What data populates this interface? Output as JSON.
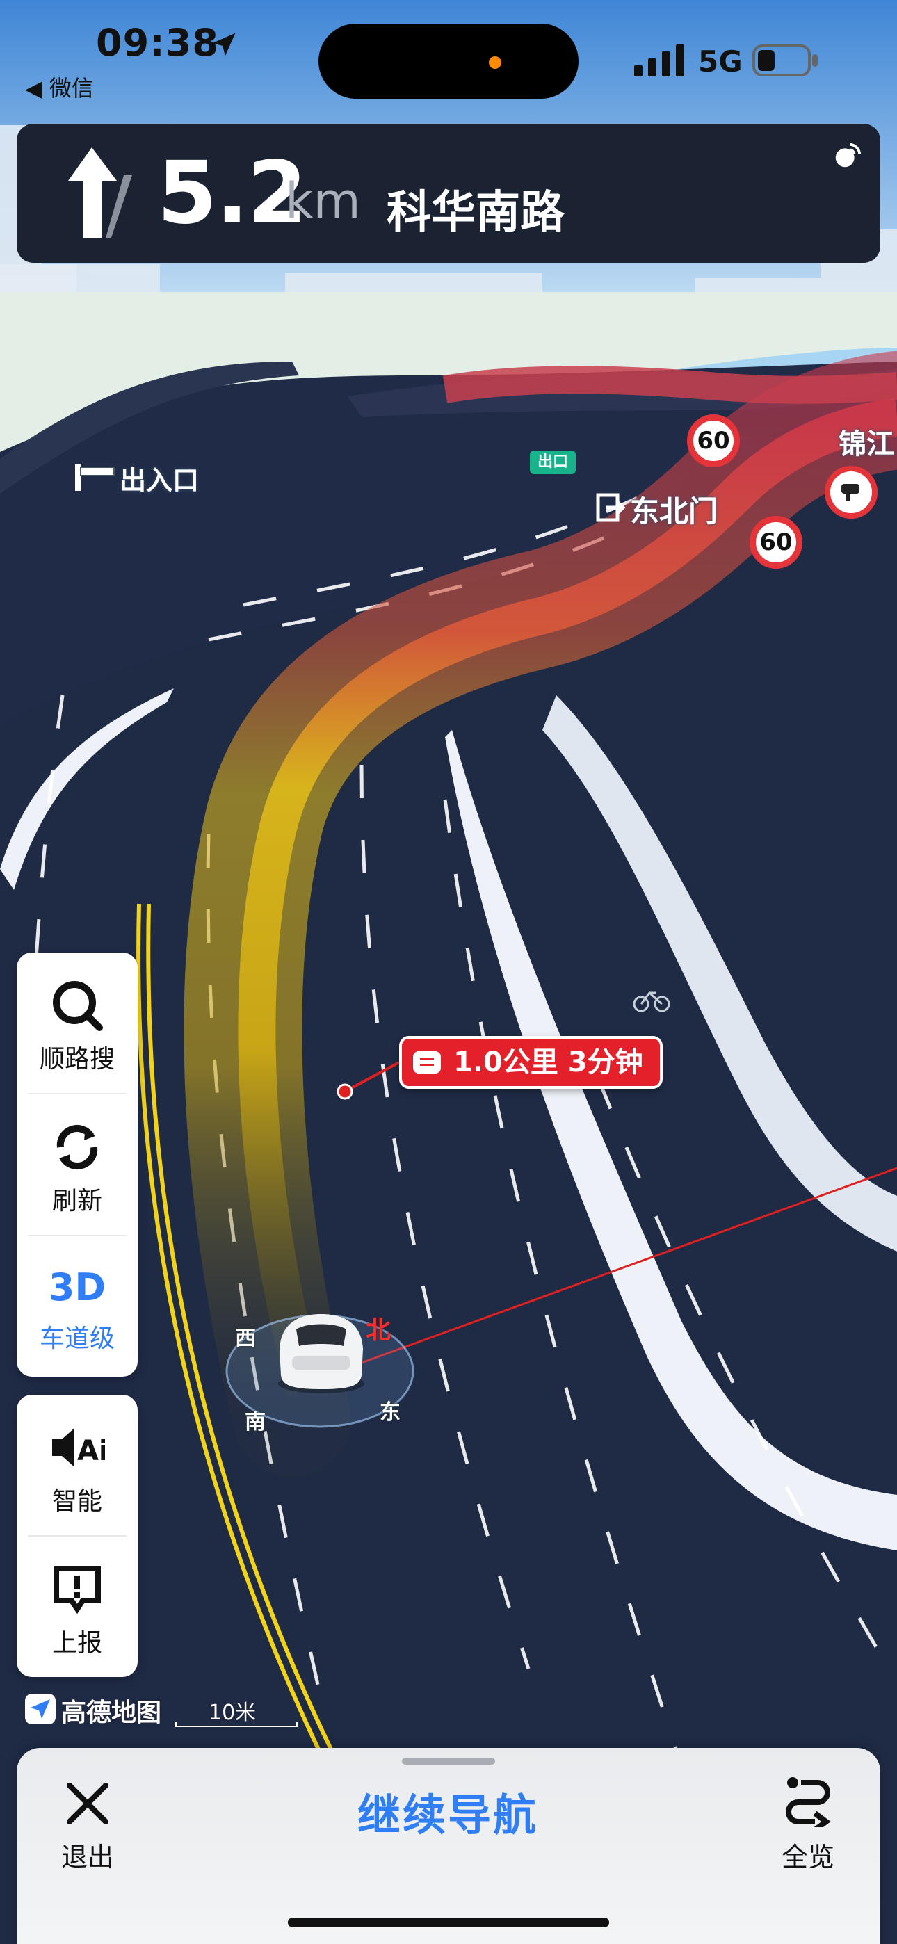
{
  "status_bar": {
    "time": "09:38",
    "back_app": "◀ 微信",
    "network": "5G"
  },
  "nav_banner": {
    "distance_value": "5.2",
    "distance_unit": "km",
    "road_name": "科华南路",
    "turn_icon": "straight-arrow-icon"
  },
  "map": {
    "labels": {
      "entrance": "出入口",
      "exit_chip": "出口",
      "gate": "东北门",
      "poi_partial": "锦江"
    },
    "speed_limits": [
      "60",
      "60"
    ],
    "route_tip": "1.0公里 3分钟",
    "compass": {
      "north": "北",
      "south": "南",
      "east": "东",
      "west": "西"
    },
    "brand": "高德地图",
    "scale": "10米",
    "colors": {
      "route_yellow": "#d8b21a",
      "route_red": "#e0464c",
      "road": "#1f2a45",
      "water": "#a9d7f2",
      "land": "#e2ede6"
    }
  },
  "side_panel": {
    "buttons": [
      {
        "label": "顺路搜",
        "icon": "search-icon"
      },
      {
        "label": "刷新",
        "icon": "refresh-icon"
      },
      {
        "label": "3D",
        "sublabel": "车道级",
        "icon": "lane-3d-icon"
      }
    ]
  },
  "side_panel2": {
    "buttons": [
      {
        "label": "智能",
        "icon": "ai-voice-icon"
      },
      {
        "label": "上报",
        "icon": "report-icon"
      }
    ]
  },
  "bottom_bar": {
    "exit_label": "退出",
    "continue_label": "继续导航",
    "overview_label": "全览"
  }
}
